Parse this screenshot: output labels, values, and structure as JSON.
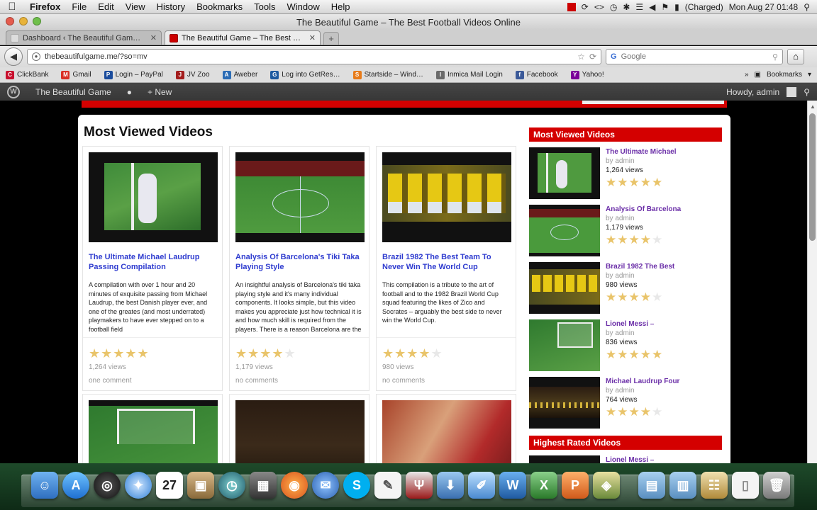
{
  "menubar": {
    "app": "Firefox",
    "items": [
      "File",
      "Edit",
      "View",
      "History",
      "Bookmarks",
      "Tools",
      "Window",
      "Help"
    ],
    "battery": "(Charged)",
    "clock": "Mon Aug 27  01:48"
  },
  "window": {
    "title": "The Beautiful Game – The Best Football Videos Online"
  },
  "tabs": [
    {
      "label": "Dashboard ‹ The Beautiful Gam…"
    },
    {
      "label": "The Beautiful Game – The Best …"
    }
  ],
  "nav": {
    "url": "thebeautifulgame.me/?so=mv",
    "search_placeholder": "Google"
  },
  "bookmarks": [
    {
      "label": "ClickBank",
      "color": "#c8102e",
      "glyph": "C"
    },
    {
      "label": "Gmail",
      "color": "#d93025",
      "glyph": "M"
    },
    {
      "label": "Login – PayPal",
      "color": "#1b4c9c",
      "glyph": "P"
    },
    {
      "label": "JV Zoo",
      "color": "#a31d1d",
      "glyph": "J"
    },
    {
      "label": "Aweber",
      "color": "#2b6cb5",
      "glyph": "A"
    },
    {
      "label": "Log into GetRes…",
      "color": "#1e5aa0",
      "glyph": "G"
    },
    {
      "label": "Startside – Wind…",
      "color": "#e77b1a",
      "glyph": "S"
    },
    {
      "label": "Inmica Mail Login",
      "color": "#6a6a6a",
      "glyph": "I"
    },
    {
      "label": "Facebook",
      "color": "#3b5998",
      "glyph": "f"
    },
    {
      "label": "Yahoo!",
      "color": "#7b0099",
      "glyph": "Y"
    }
  ],
  "bookmarks_menu": "Bookmarks",
  "wpbar": {
    "site": "The Beautiful Game",
    "new": "New",
    "howdy": "Howdy, admin"
  },
  "main": {
    "title": "Most Viewed Videos",
    "videos": [
      {
        "title": "The Ultimate Michael Laudrup Passing Compilation",
        "desc": "A compilation with over 1 hour and 20 minutes of exquisite passing from Michael Laudrup, the best Danish player ever, and one of the greates (and most underrated) playmakers to have ever stepped on to a football field",
        "stars": 5,
        "views": "1,264 views",
        "comments": "one comment"
      },
      {
        "title": "Analysis Of Barcelona's Tiki Taka Playing Style",
        "desc": "An insightful analysis of Barcelona's tiki taka playing style and it's many individual components. It looks simple, but this video makes you appreciate just how technical it is and how much skill is required from the players. There is a reason Barcelona are the best team in",
        "stars": 4,
        "views": "1,179 views",
        "comments": "no comments"
      },
      {
        "title": "Brazil 1982 The Best Team To Never Win The World Cup",
        "desc": "This compilation is a tribute to the art of football and to the 1982 Brazil World Cup squad featuring the likes of Zico and Socrates – arguably the best side to never win the World Cup.",
        "stars": 4,
        "views": "980 views",
        "comments": "no comments"
      }
    ]
  },
  "sidebar": {
    "most_viewed_title": "Most Viewed Videos",
    "highest_rated_title": "Highest Rated Videos",
    "items": [
      {
        "title": "The Ultimate Michael",
        "by": "by admin",
        "views": "1,264 views",
        "stars": 5
      },
      {
        "title": "Analysis Of Barcelona",
        "by": "by admin",
        "views": "1,179 views",
        "stars": 4
      },
      {
        "title": "Brazil 1982 The Best",
        "by": "by admin",
        "views": "980 views",
        "stars": 4
      },
      {
        "title": "Lionel Messi –",
        "by": "by admin",
        "views": "836 views",
        "stars": 5
      },
      {
        "title": "Michael Laudrup Four",
        "by": "by admin",
        "views": "764 views",
        "stars": 4
      }
    ],
    "highest_rated_first": "Lionel Messi –"
  },
  "colors": {
    "accent_red": "#d40000",
    "link_blue": "#2f3ccf",
    "link_purple": "#6b2fa8",
    "star": "#e9c46a"
  }
}
